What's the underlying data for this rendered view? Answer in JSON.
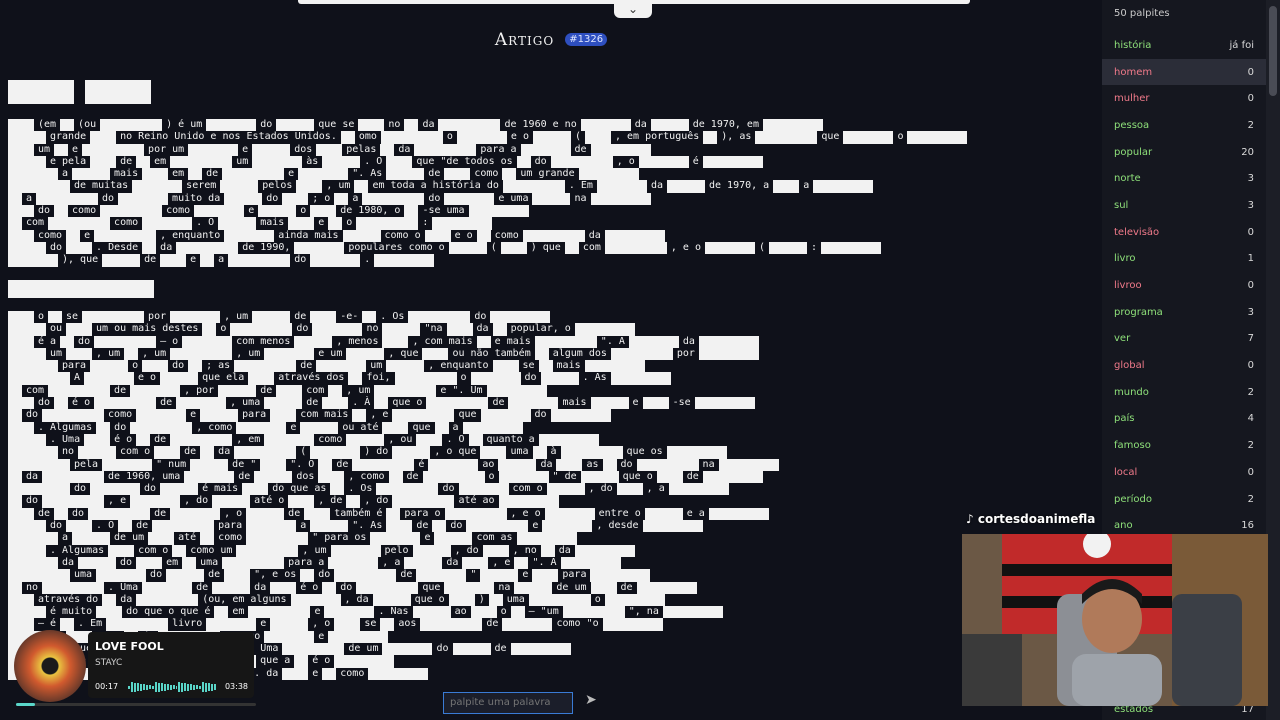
{
  "header": {
    "title": "Artigo",
    "badge": "#1326"
  },
  "sidebar": {
    "count_label": "50 palpites",
    "items": [
      {
        "word": "história",
        "value": "já foi",
        "color": "#8ee07a"
      },
      {
        "word": "homem",
        "value": "0",
        "color": "#f07a8a"
      },
      {
        "word": "mulher",
        "value": "0",
        "color": "#f07a8a"
      },
      {
        "word": "pessoa",
        "value": "2",
        "color": "#8ee07a"
      },
      {
        "word": "popular",
        "value": "20",
        "color": "#8ee07a"
      },
      {
        "word": "norte",
        "value": "3",
        "color": "#8ee07a"
      },
      {
        "word": "sul",
        "value": "3",
        "color": "#8ee07a"
      },
      {
        "word": "televisão",
        "value": "0",
        "color": "#f07a8a"
      },
      {
        "word": "livro",
        "value": "1",
        "color": "#8ee07a"
      },
      {
        "word": "livroo",
        "value": "0",
        "color": "#f07a8a"
      },
      {
        "word": "programa",
        "value": "3",
        "color": "#8ee07a"
      },
      {
        "word": "ver",
        "value": "7",
        "color": "#8ee07a"
      },
      {
        "word": "global",
        "value": "0",
        "color": "#f07a8a"
      },
      {
        "word": "mundo",
        "value": "2",
        "color": "#8ee07a"
      },
      {
        "word": "país",
        "value": "4",
        "color": "#8ee07a"
      },
      {
        "word": "famoso",
        "value": "2",
        "color": "#8ee07a"
      },
      {
        "word": "local",
        "value": "0",
        "color": "#f07a8a"
      },
      {
        "word": "período",
        "value": "2",
        "color": "#8ee07a"
      },
      {
        "word": "ano",
        "value": "16",
        "color": "#8ee07a"
      }
    ],
    "bottom_item": {
      "word": "estados",
      "value": "17"
    }
  },
  "guess_input": {
    "placeholder": "palpite uma palavra"
  },
  "music": {
    "song": "LOVE FOOL",
    "artist": "STAYC",
    "elapsed": "00:17",
    "duration": "03:38",
    "progress": 0.08
  },
  "stream": {
    "handle": "cortesdoanimefla"
  },
  "article": {
    "intro_lines": [
      "(em                  (ou       ) é um         do    que se            no        da         de 1960 e no        da        de 1970, em",
      "grande   no Reino Unido e nos Estados Unidos.  omo   o      e o    (       , em português          ), as    que     o",
      "um     e         por um        e       dos       pelas      da       para a     de",
      "e pela   de   em   um   às   . O   que \"de todos os   do   , o   é",
      "a  mais  em  de  e  \". As  de  como  um grande",
      "de muitas  serem  pelos  , um  em toda a história do  . Em  da  de 1970, a  a",
      "a  do  muito da  do  ; o  a  do  e uma  na",
      "do  como  como  e  o  de 1980, o  -se uma",
      "com  como  . O  mais  e  o  :",
      "como  e  , enquanto  ainda mais  como o  e o  como  da",
      "do  . Desde  da  de 1990,  populares como o  (  ) que  com  , e o  (  :",
      "), que  de  e  a  do  ."
    ],
    "body_lines": [
      "o  se  por  , um  de  -e-  . Os  do",
      "ou  um ou mais destes  o  do  no  \"na  da  popular, o",
      "é a  do  — o  com menos  , menos  , com mais  e mais  \". A  da",
      "um  , um  , um  , um  e um  , que  ou não também  algum dos  por",
      "para  o  do  ; as  de  um  , enquanto  se  mais",
      "A  e o  que ela  através dos  foi,  o  do  . As",
      "com  de  , por  de  com  , um  e \". Um",
      "do  é o  de  , uma  de  . À  que o  de  mais  e  -se",
      "do  como  e  para  com mais  , e  que  do",
      ". Algumas  do  , como  e  ou até  que  a",
      ". Uma  é o  de  , em  como  , ou  . O  quanto a",
      "no  com o  de  da  (  ) do  , o que  uma  à  que os",
      "pela  \" num  de \"  \". O  de  é  ao  da  as  do  na",
      "da  de 1960, uma  de  dos  , como  de  o  \" de  que o  de",
      "do  do  é mais  do que as  . Os  do  com o  , do  , a",
      "do  , e  , do  até o  , de  , do  até ao",
      "de  do  de  , o  de  também é  para o  , e o  entre o  e a",
      "do  . O  de  para  a  \". As  de  do  e  , desde",
      "a  de um  até  como  \" para os  e  com as",
      ". Algumas  com o  como um  , um  pelo  , do  , no  da",
      "da  do  em  uma  para a  , a  da  , e  \". A",
      "uma  do  de  \", e os  do  de  \"  e  para",
      "no  . Uma  de  da  é o  do  que  na  de um  de",
      "através do  da  (ou, em alguns  , da  que o  )  uma  o",
      "é muito  do que o que é  em  e  . Nas  ao  o  — \"um  \", na",
      "— é  . Em  livro  e  , o  se  aos  de  como \"o",
      "de  , as  de  , como  e",
      "o que  é que  mais  \" Uma  de um  do  de",
      "no  da  , da  que a  é o",
      "os  do  , com  . da  e  como"
    ]
  }
}
